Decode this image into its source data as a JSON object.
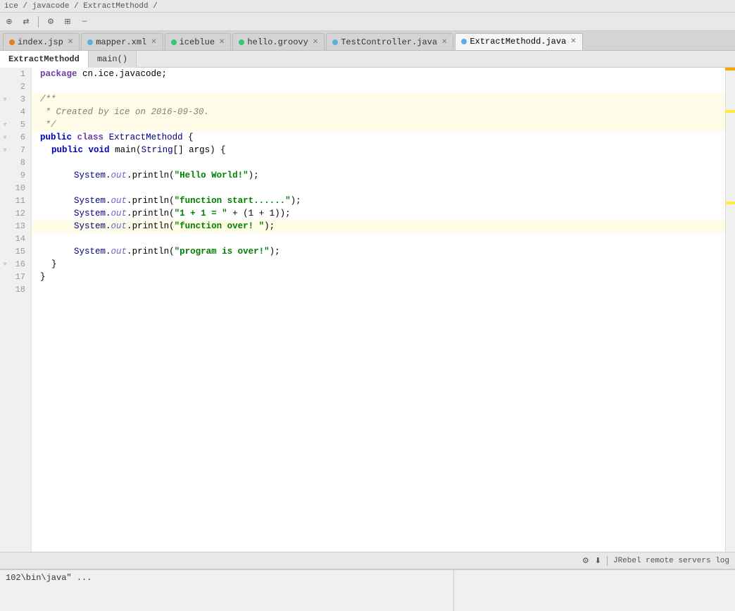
{
  "breadcrumb": {
    "text": "ice / javacode / ExtractMethodd /"
  },
  "toolbar": {
    "icons": [
      "⊕",
      "⇄",
      "⚙",
      "⊞",
      "—"
    ]
  },
  "tabs": [
    {
      "id": "index-jsp",
      "label": "index.jsp",
      "color": "#e67e22",
      "active": false
    },
    {
      "id": "mapper-xml",
      "label": "mapper.xml",
      "color": "#5dade2",
      "active": false
    },
    {
      "id": "iceblue",
      "label": "iceblue",
      "color": "#2ecc71",
      "active": false
    },
    {
      "id": "hello-groovy",
      "label": "hello.groovy",
      "color": "#2ecc71",
      "active": false
    },
    {
      "id": "test-controller",
      "label": "TestController.java",
      "color": "#5dade2",
      "active": false
    },
    {
      "id": "extract-methord",
      "label": "ExtractMethodd.java",
      "color": "#5dade2",
      "active": true
    }
  ],
  "sub_tabs": [
    {
      "id": "extract-methord-tab",
      "label": "ExtractMethodd",
      "active": true
    },
    {
      "id": "main-tab",
      "label": "main()",
      "active": false
    }
  ],
  "lines": [
    {
      "num": 1,
      "content": "package cn.ice.javacode;",
      "type": "plain",
      "highlighted": false
    },
    {
      "num": 2,
      "content": "",
      "type": "plain",
      "highlighted": false
    },
    {
      "num": 3,
      "content": "/**",
      "type": "comment",
      "highlighted": true,
      "fold": true
    },
    {
      "num": 4,
      "content": " * Created by ice on 2016-09-30.",
      "type": "comment",
      "highlighted": true
    },
    {
      "num": 5,
      "content": " */",
      "type": "comment",
      "highlighted": true,
      "fold_end": true
    },
    {
      "num": 6,
      "content": "public class ExtractMethodd {",
      "type": "class",
      "highlighted": false,
      "fold": true
    },
    {
      "num": 7,
      "content": "    public void main(String[] args) {",
      "type": "method",
      "highlighted": false,
      "fold": true
    },
    {
      "num": 8,
      "content": "",
      "type": "plain",
      "highlighted": false
    },
    {
      "num": 9,
      "content": "        System.out.println(\"Hello World!\");",
      "type": "code",
      "highlighted": false
    },
    {
      "num": 10,
      "content": "",
      "type": "plain",
      "highlighted": false
    },
    {
      "num": 11,
      "content": "        System.out.println(\"function start......\");",
      "type": "code",
      "highlighted": false
    },
    {
      "num": 12,
      "content": "        System.out.println(\"1 + 1 = \" + (1 + 1));",
      "type": "code",
      "highlighted": false
    },
    {
      "num": 13,
      "content": "        System.out.println(\"function over! \");",
      "type": "code",
      "highlighted": true
    },
    {
      "num": 14,
      "content": "",
      "type": "plain",
      "highlighted": false
    },
    {
      "num": 15,
      "content": "        System.out.println(\"program is over!\");",
      "type": "code",
      "highlighted": false
    },
    {
      "num": 16,
      "content": "    }",
      "type": "plain",
      "highlighted": false,
      "fold_end": true
    },
    {
      "num": 17,
      "content": "}",
      "type": "plain",
      "highlighted": false
    },
    {
      "num": 18,
      "content": "",
      "type": "plain",
      "highlighted": false
    }
  ],
  "status_bar": {
    "gear_label": "⚙",
    "download_label": "⬇",
    "jrebel_label": "JRebel remote servers log"
  },
  "bottom_panel": {
    "terminal_text": "102\\bin\\java\" ...",
    "right_panel_label": ""
  }
}
